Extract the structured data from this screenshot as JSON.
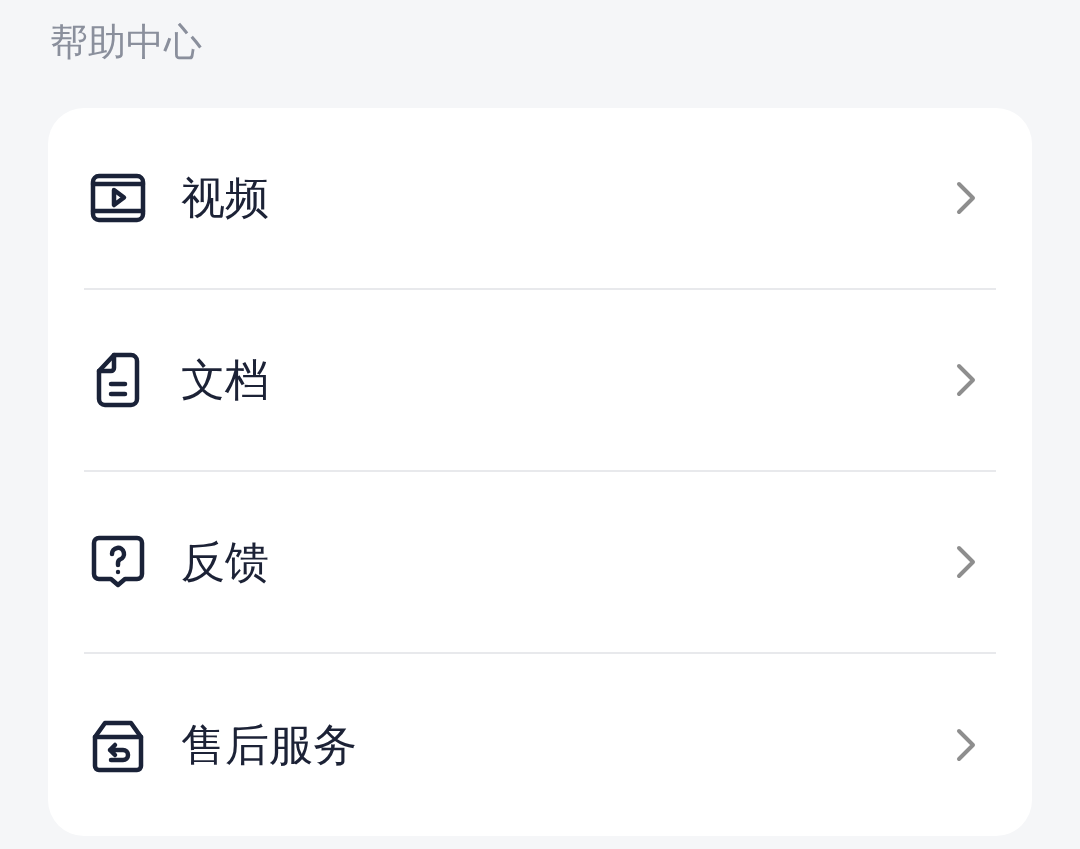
{
  "title": "帮助中心",
  "items": [
    {
      "kind": "video",
      "label": "视频"
    },
    {
      "kind": "document",
      "label": "文档"
    },
    {
      "kind": "feedback",
      "label": "反馈"
    },
    {
      "kind": "after_sales",
      "label": "售后服务"
    }
  ]
}
